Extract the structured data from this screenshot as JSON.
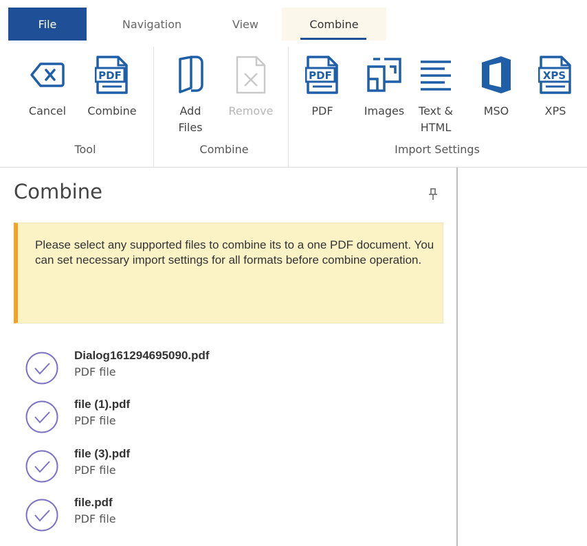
{
  "tabs": {
    "file": "File",
    "navigation": "Navigation",
    "view": "View",
    "combine": "Combine"
  },
  "ribbon": {
    "groups": {
      "tool": "Tool",
      "combine": "Combine",
      "import_settings": "Import Settings"
    },
    "buttons": {
      "cancel": "Cancel",
      "combine": "Combine",
      "add_files": "Add\nFiles",
      "remove": "Remove",
      "pdf": "PDF",
      "images": "Images",
      "text_html": "Text &\nHTML",
      "mso": "MSO",
      "xps": "XPS"
    },
    "icon_texts": {
      "pdf": "PDF",
      "xps": "XPS"
    },
    "icons": {
      "cancel": "backspace-x-icon",
      "combine": "pdf-document-icon",
      "add_files": "add-files-icon",
      "remove": "remove-file-icon",
      "pdf": "pdf-document-icon",
      "images": "images-grid-icon",
      "text_html": "text-lines-icon",
      "mso": "office-icon",
      "xps": "xps-document-icon"
    }
  },
  "panel": {
    "title": "Combine",
    "notice": "Please select any supported files to combine its to a one PDF document. You can set necessary import settings for all formats before combine operation.",
    "files": [
      {
        "name": "Dialog161294695090.pdf",
        "type": "PDF file"
      },
      {
        "name": "file (1).pdf",
        "type": "PDF file"
      },
      {
        "name": "file (3).pdf",
        "type": "PDF file"
      },
      {
        "name": "file.pdf",
        "type": "PDF file"
      }
    ]
  },
  "colors": {
    "accent": "#1f4f96",
    "notice_bg": "#fbf2c6",
    "notice_border": "#f0a22a",
    "check": "#7b72c4",
    "disabled": "#b6b6b6"
  }
}
